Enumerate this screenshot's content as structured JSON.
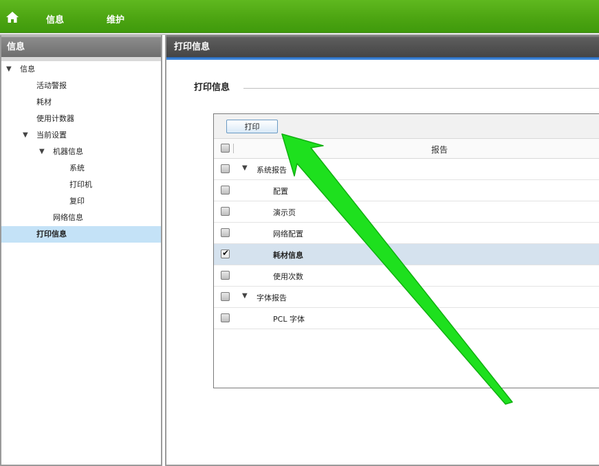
{
  "topnav": {
    "home_icon": "home-icon",
    "items": [
      {
        "label": "信息"
      },
      {
        "label": "维护"
      }
    ],
    "color": "#4da512"
  },
  "sidebar": {
    "title": "信息",
    "items": [
      {
        "label": "信息",
        "expanded": true
      },
      {
        "label": "活动警报"
      },
      {
        "label": "耗材"
      },
      {
        "label": "使用计数器"
      },
      {
        "label": "当前设置",
        "expanded": true
      },
      {
        "label": "机器信息",
        "expanded": true
      },
      {
        "label": "系统"
      },
      {
        "label": "打印机"
      },
      {
        "label": "复印"
      },
      {
        "label": "网络信息"
      },
      {
        "label": "打印信息",
        "selected": true
      }
    ],
    "selected_color": "#c4e2f7"
  },
  "main": {
    "header_title": "打印信息",
    "section_title": "打印信息",
    "print_button_label": "打印",
    "column_header": "报告",
    "rows": [
      {
        "label": "系统报告",
        "group": true,
        "checked": false
      },
      {
        "label": "配置",
        "checked": false
      },
      {
        "label": "演示页",
        "checked": false
      },
      {
        "label": "网络配置",
        "checked": false
      },
      {
        "label": "耗材信息",
        "checked": true,
        "selected": true
      },
      {
        "label": "使用次数",
        "checked": false
      },
      {
        "label": "字体报告",
        "group": true,
        "checked": false
      },
      {
        "label": "PCL 字体",
        "checked": false
      }
    ],
    "accent_line_color": "#3b82d6"
  },
  "annotation": {
    "arrow_color": "#1ee01e"
  }
}
